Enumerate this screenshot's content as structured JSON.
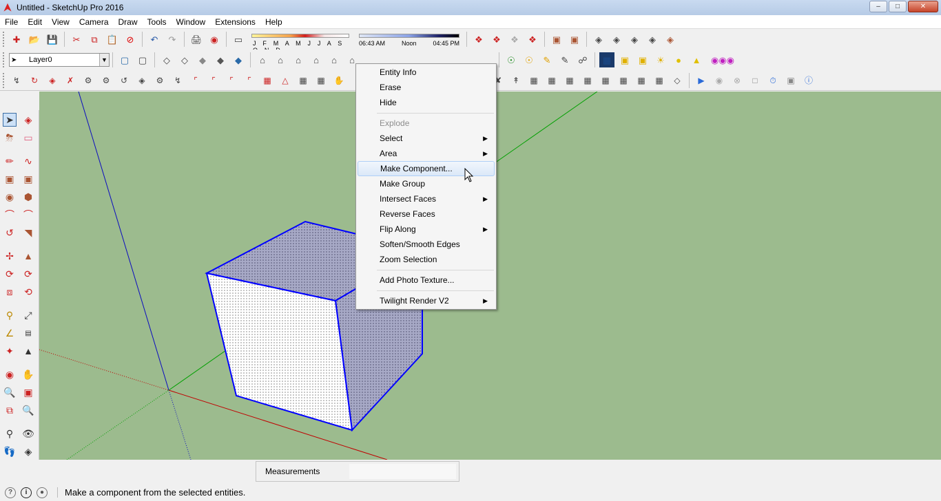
{
  "window": {
    "title": "Untitled - SketchUp Pro 2016",
    "controls": [
      "minimize",
      "maximize",
      "close"
    ]
  },
  "menu": [
    "File",
    "Edit",
    "View",
    "Camera",
    "Draw",
    "Tools",
    "Window",
    "Extensions",
    "Help"
  ],
  "shadow_settings": {
    "months": "J F M A M J J A S O N D",
    "time_start": "06:43 AM",
    "time_noon": "Noon",
    "time_end": "04:45 PM"
  },
  "layer": {
    "current": "Layer0"
  },
  "context_menu": {
    "items": [
      {
        "label": "Entity Info",
        "enabled": true,
        "submenu": false
      },
      {
        "label": "Erase",
        "enabled": true,
        "submenu": false
      },
      {
        "label": "Hide",
        "enabled": true,
        "submenu": false
      },
      {
        "label": "Explode",
        "enabled": false,
        "submenu": false
      },
      {
        "label": "Select",
        "enabled": true,
        "submenu": true
      },
      {
        "label": "Area",
        "enabled": true,
        "submenu": true
      },
      {
        "label": "Make Component...",
        "enabled": true,
        "submenu": false,
        "highlighted": true
      },
      {
        "label": "Make Group",
        "enabled": true,
        "submenu": false
      },
      {
        "label": "Intersect Faces",
        "enabled": true,
        "submenu": true
      },
      {
        "label": "Reverse Faces",
        "enabled": true,
        "submenu": false
      },
      {
        "label": "Flip Along",
        "enabled": true,
        "submenu": true
      },
      {
        "label": "Soften/Smooth Edges",
        "enabled": true,
        "submenu": false
      },
      {
        "label": "Zoom Selection",
        "enabled": true,
        "submenu": false
      },
      {
        "label": "Add Photo Texture...",
        "enabled": true,
        "submenu": false
      },
      {
        "label": "Twilight Render V2",
        "enabled": true,
        "submenu": true
      }
    ]
  },
  "measurements": {
    "label": "Measurements",
    "value": ""
  },
  "status": {
    "hint": "Make a component from the selected entities."
  },
  "colors": {
    "viewport_bg": "#9cbb8e",
    "selection": "#0000ff",
    "axis_red": "#c00000",
    "axis_green": "#00a000",
    "axis_blue": "#0000c0"
  }
}
